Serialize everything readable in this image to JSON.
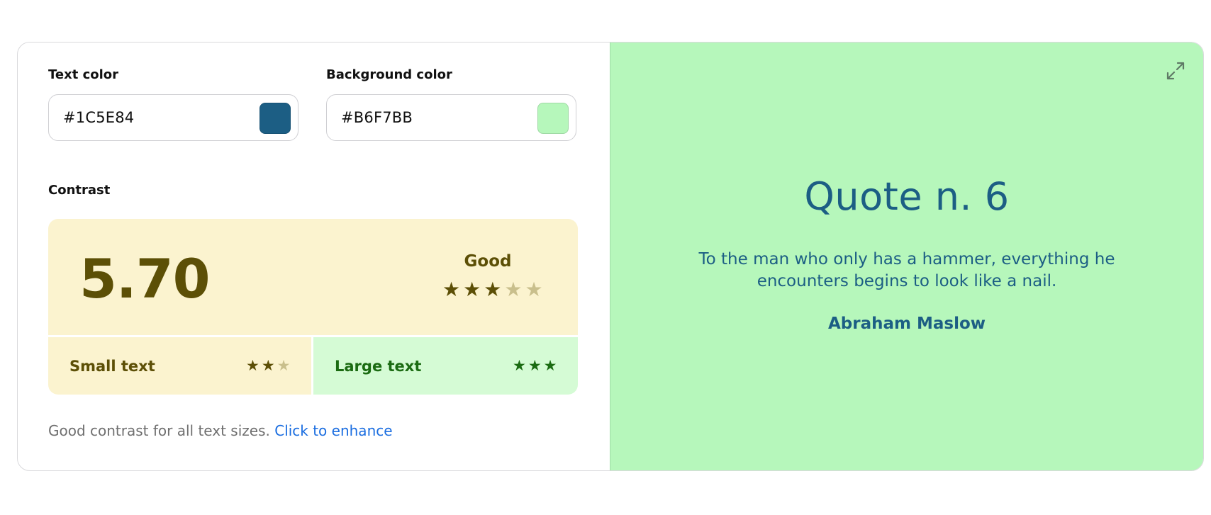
{
  "colors": {
    "text_label": "Text color",
    "text_value": "#1C5E84",
    "background_label": "Background color",
    "background_value": "#B6F7BB"
  },
  "contrast": {
    "label": "Contrast",
    "ratio": "5.70",
    "grade": "Good",
    "grade_stars": 3,
    "grade_stars_max": 5,
    "small_text": {
      "label": "Small text",
      "stars": 2,
      "stars_max": 3
    },
    "large_text": {
      "label": "Large text",
      "stars": 3,
      "stars_max": 3
    },
    "status_colors": {
      "good_bg": "#fbf3cf",
      "good_fg": "#5c4f06",
      "pass_bg": "#d5fbd5",
      "pass_fg": "#1b6b12",
      "star_off": "#c9bf8c"
    }
  },
  "footer": {
    "message": "Good contrast for all text sizes.",
    "link": "Click to enhance"
  },
  "preview": {
    "title": "Quote n. 6",
    "quote": "To the man who only has a hammer, everything he encounters begins to look like a nail.",
    "author": "Abraham Maslow",
    "expand_icon": "expand-icon"
  }
}
